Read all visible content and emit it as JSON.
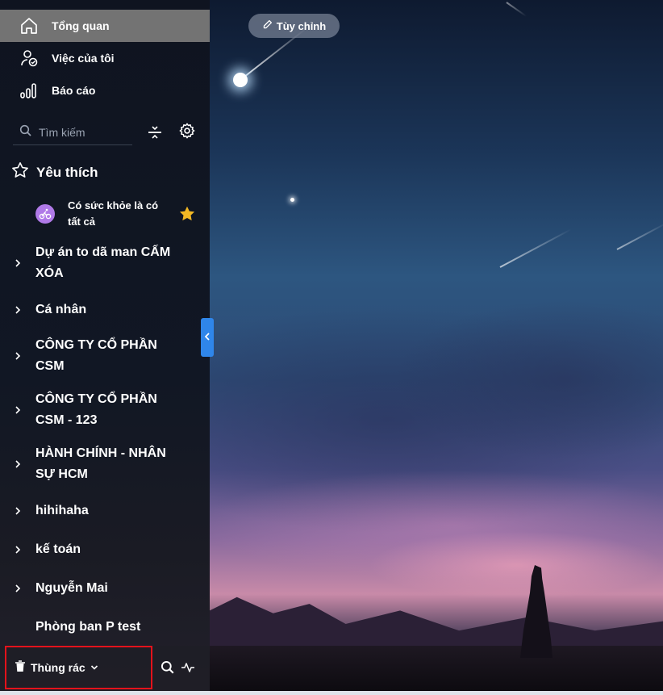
{
  "customize": {
    "label": "Tùy chỉnh",
    "icon": "pencil-icon"
  },
  "nav": [
    {
      "label": "Tổng quan",
      "icon": "home-icon",
      "active": true
    },
    {
      "label": "Việc của tôi",
      "icon": "user-check-icon",
      "active": false
    },
    {
      "label": "Báo cáo",
      "icon": "bar-chart-icon",
      "active": false
    }
  ],
  "search": {
    "placeholder": "Tìm kiếm"
  },
  "favorites": {
    "title": "Yêu thích",
    "items": [
      {
        "label": "Có sức khỏe là có tất cả",
        "icon": "cycling-icon",
        "starred": true
      }
    ]
  },
  "groups": [
    {
      "label": "Dự án to dã man CẤM XÓA",
      "expandable": true
    },
    {
      "label": "Cá nhân",
      "expandable": true
    },
    {
      "label": "CÔNG TY CỔ PHẦN CSM",
      "expandable": true
    },
    {
      "label": "CÔNG TY CỔ PHẦN CSM - 123",
      "expandable": true
    },
    {
      "label": "HÀNH CHÍNH - NHÂN SỰ HCM",
      "expandable": true
    },
    {
      "label": "hihihaha",
      "expandable": true
    },
    {
      "label": "kế toán",
      "expandable": true
    },
    {
      "label": "Nguyễn Mai",
      "expandable": true
    },
    {
      "label": "Phòng ban P test",
      "expandable": false
    }
  ],
  "footer": {
    "trash_label": "Thùng rác"
  },
  "colors": {
    "accent": "#2f86ea",
    "highlight": "#e3121b",
    "star": "#f2b824",
    "avatar": "#b07ae8"
  }
}
